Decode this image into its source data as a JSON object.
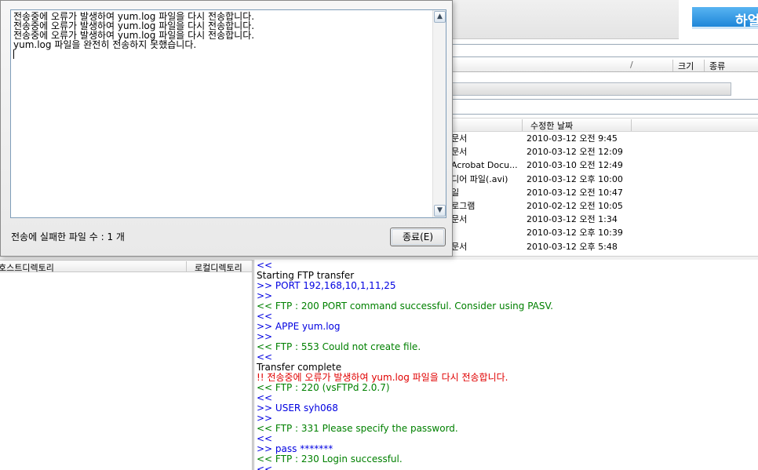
{
  "toolbar": {
    "remote_button_label": "하얼"
  },
  "file_panel": {
    "column_headers": {
      "size": "크기",
      "type": "종류",
      "modified": "수정한 날짜"
    },
    "rows": [
      {
        "type": "문서",
        "date": "2010-03-12 오전 9:45"
      },
      {
        "type": "문서",
        "date": "2010-03-12 오전 12:09"
      },
      {
        "type": "Acrobat Docu...",
        "date": "2010-03-10 오전 12:49"
      },
      {
        "type": "디어 파일(.avi)",
        "date": "2010-03-12 오후 10:00"
      },
      {
        "type": "일",
        "date": "2010-03-12 오전 10:47"
      },
      {
        "type": "로그램",
        "date": "2010-02-12 오전 10:05"
      },
      {
        "type": "문서",
        "date": "2010-03-12 오전 1:34"
      },
      {
        "type": "",
        "date": "2010-03-12 오후 10:39"
      },
      {
        "type": "문서",
        "date": "2010-03-12 오후 5:48"
      }
    ]
  },
  "dir_headers": {
    "host": "호스트디렉토리",
    "local": "로컬디렉토리"
  },
  "log": [
    {
      "text": "<<",
      "color": "blue"
    },
    {
      "text": "Starting FTP transfer",
      "color": "black"
    },
    {
      "text": ">> PORT 192,168,10,1,11,25",
      "color": "blue"
    },
    {
      "text": ">>",
      "color": "blue"
    },
    {
      "text": "<< FTP : 200 PORT command successful. Consider using PASV.",
      "color": "green"
    },
    {
      "text": "<<",
      "color": "blue"
    },
    {
      "text": ">> APPE yum.log",
      "color": "blue"
    },
    {
      "text": ">>",
      "color": "blue"
    },
    {
      "text": "<< FTP : 553 Could not create file.",
      "color": "green"
    },
    {
      "text": "<<",
      "color": "blue"
    },
    {
      "text": "Transfer complete",
      "color": "black"
    },
    {
      "text": "!! 전송중에 오류가 발생하여 yum.log 파일을 다시 전송합니다.",
      "color": "red"
    },
    {
      "text": "<< FTP : 220 (vsFTPd 2.0.7)",
      "color": "green"
    },
    {
      "text": "<<",
      "color": "blue"
    },
    {
      "text": ">> USER syh068",
      "color": "blue"
    },
    {
      "text": ">>",
      "color": "blue"
    },
    {
      "text": "<< FTP : 331 Please specify the password.",
      "color": "green"
    },
    {
      "text": "<<",
      "color": "blue"
    },
    {
      "text": ">> pass *******",
      "color": "blue"
    },
    {
      "text": "<< FTP : 230 Login successful.",
      "color": "green"
    },
    {
      "text": "<<",
      "color": "blue"
    }
  ],
  "dialog": {
    "messages": [
      "전송중에 오류가 발생하여 yum.log 파일을 다시 전송합니다.",
      "전송중에 오류가 발생하여 yum.log 파일을 다시 전송합니다.",
      "전송중에 오류가 발생하여 yum.log 파일을 다시 전송합니다.",
      "yum.log 파일을 완전히 전송하지 못했습니다."
    ],
    "status": "전송에 실패한 파일 수 : 1 개",
    "close_label": "종료(E)",
    "scroll_up_icon": "triangle-up",
    "scroll_down_icon": "triangle-down"
  },
  "colors": {
    "accent": "#1e86d8",
    "log_blue": "#0000e0",
    "log_green": "#008000",
    "log_red": "#e00000"
  }
}
